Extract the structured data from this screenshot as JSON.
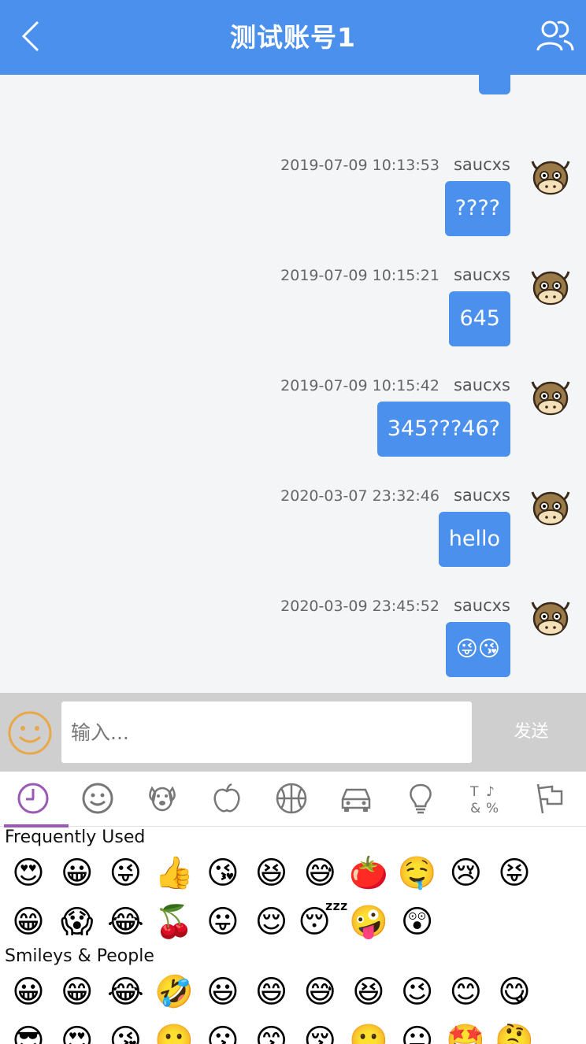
{
  "header": {
    "title": "测试账号1"
  },
  "messages": [
    {
      "time": "",
      "user": "",
      "text": "?"
    },
    {
      "time": "2019-07-09 10:13:53",
      "user": "saucxs",
      "text": "????"
    },
    {
      "time": "2019-07-09 10:15:21",
      "user": "saucxs",
      "text": "645"
    },
    {
      "time": "2019-07-09 10:15:42",
      "user": "saucxs",
      "text": "345???46?"
    },
    {
      "time": "2020-03-07 23:32:46",
      "user": "saucxs",
      "text": "hello"
    },
    {
      "time": "2020-03-09 23:45:52",
      "user": "saucxs",
      "text": "😜😘"
    }
  ],
  "input": {
    "placeholder": "输入...",
    "send_label": "发送"
  },
  "emoji_panel": {
    "tabs": [
      "recent-icon",
      "smiley-icon",
      "dog-icon",
      "apple-icon",
      "basketball-icon",
      "car-icon",
      "lightbulb-icon",
      "symbols-icon",
      "flag-icon"
    ],
    "sections": [
      {
        "title": "Frequently Used",
        "emojis": [
          "😍",
          "😀",
          "😜",
          "👍",
          "😘",
          "😆",
          "😅",
          "🍅",
          "🤤",
          "😢",
          "😝",
          "😁",
          "😱",
          "😂",
          "🍒",
          "😛",
          "😌",
          "😴",
          "🤪",
          "😲"
        ]
      },
      {
        "title": "Smileys & People",
        "emojis": [
          "😀",
          "😁",
          "😂",
          "🤣",
          "😃",
          "😄",
          "😅",
          "😆",
          "😉",
          "😊",
          "😋",
          "😎",
          "😍",
          "😘",
          "🙂",
          "😗",
          "😙",
          "😚",
          "🙂",
          "😐",
          "🤩",
          "🤔"
        ]
      }
    ]
  }
}
